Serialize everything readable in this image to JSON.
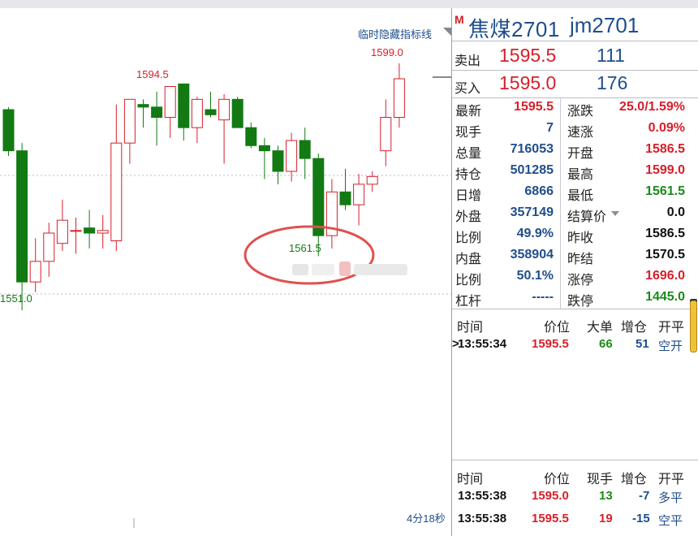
{
  "chart": {
    "hide_indicator_label": "临时隐藏指标线",
    "high_label": "1594.5",
    "high2_label": "1599.0",
    "low_label": "1561.5",
    "left_low_label": "1551.0",
    "countdown": "4分18秒",
    "colors": {
      "up": "#d6202a",
      "down": "#137a13",
      "annotation": "#e0504f"
    }
  },
  "chart_data": {
    "type": "candlestick",
    "ylim": [
      1545,
      1605
    ],
    "candles": [
      {
        "o": 1590.0,
        "h": 1590.5,
        "l": 1581.0,
        "c": 1582.0
      },
      {
        "o": 1582.0,
        "h": 1583.5,
        "l": 1551.0,
        "c": 1556.5
      },
      {
        "o": 1556.5,
        "h": 1565.0,
        "l": 1554.5,
        "c": 1560.5
      },
      {
        "o": 1560.5,
        "h": 1568.0,
        "l": 1557.5,
        "c": 1566.0
      },
      {
        "o": 1564.0,
        "h": 1572.5,
        "l": 1562.5,
        "c": 1568.5
      },
      {
        "o": 1566.5,
        "h": 1569.0,
        "l": 1562.0,
        "c": 1566.5
      },
      {
        "o": 1567.0,
        "h": 1570.5,
        "l": 1563.0,
        "c": 1566.0
      },
      {
        "o": 1566.0,
        "h": 1569.5,
        "l": 1563.0,
        "c": 1566.5
      },
      {
        "o": 1564.5,
        "h": 1591.0,
        "l": 1562.5,
        "c": 1583.5
      },
      {
        "o": 1583.5,
        "h": 1592.0,
        "l": 1579.5,
        "c": 1592.0
      },
      {
        "o": 1591.0,
        "h": 1592.0,
        "l": 1586.5,
        "c": 1590.5
      },
      {
        "o": 1590.5,
        "h": 1593.5,
        "l": 1583.0,
        "c": 1588.5
      },
      {
        "o": 1588.5,
        "h": 1594.5,
        "l": 1584.5,
        "c": 1594.5
      },
      {
        "o": 1595.0,
        "h": 1595.0,
        "l": 1584.0,
        "c": 1586.5
      },
      {
        "o": 1586.5,
        "h": 1592.5,
        "l": 1583.5,
        "c": 1592.0
      },
      {
        "o": 1590.0,
        "h": 1593.5,
        "l": 1588.5,
        "c": 1589.0
      },
      {
        "o": 1588.0,
        "h": 1593.0,
        "l": 1579.5,
        "c": 1592.0
      },
      {
        "o": 1592.0,
        "h": 1592.5,
        "l": 1586.5,
        "c": 1586.5
      },
      {
        "o": 1586.5,
        "h": 1587.5,
        "l": 1582.5,
        "c": 1583.0
      },
      {
        "o": 1583.0,
        "h": 1584.5,
        "l": 1576.5,
        "c": 1582.0
      },
      {
        "o": 1582.0,
        "h": 1583.0,
        "l": 1575.5,
        "c": 1578.0
      },
      {
        "o": 1578.0,
        "h": 1585.5,
        "l": 1576.0,
        "c": 1584.0
      },
      {
        "o": 1584.0,
        "h": 1586.5,
        "l": 1576.5,
        "c": 1580.5
      },
      {
        "o": 1580.5,
        "h": 1581.5,
        "l": 1561.5,
        "c": 1565.5
      },
      {
        "o": 1565.5,
        "h": 1576.5,
        "l": 1563.0,
        "c": 1574.0
      },
      {
        "o": 1574.0,
        "h": 1578.5,
        "l": 1570.5,
        "c": 1571.5
      },
      {
        "o": 1571.5,
        "h": 1577.5,
        "l": 1567.5,
        "c": 1575.5
      },
      {
        "o": 1575.5,
        "h": 1578.0,
        "l": 1574.0,
        "c": 1577.0
      },
      {
        "o": 1582.0,
        "h": 1592.0,
        "l": 1579.0,
        "c": 1588.5
      },
      {
        "o": 1588.5,
        "h": 1599.0,
        "l": 1586.5,
        "c": 1596.0
      }
    ]
  },
  "panel": {
    "badge": "M",
    "name": "焦煤2701",
    "code": "jm2701",
    "sell_label": "卖出",
    "sell_price": "1595.5",
    "sell_vol": "111",
    "buy_label": "买入",
    "buy_price": "1595.0",
    "buy_vol": "176",
    "stats_left": [
      {
        "label": "最新",
        "value": "1595.5",
        "color": "red"
      },
      {
        "label": "现手",
        "value": "7",
        "color": "blue"
      },
      {
        "label": "总量",
        "value": "716053",
        "color": "blue"
      },
      {
        "label": "持仓",
        "value": "501285",
        "color": "blue"
      },
      {
        "label": "日增",
        "value": "6866",
        "color": "blue"
      },
      {
        "label": "外盘",
        "value": "357149",
        "color": "blue"
      },
      {
        "label": "比例",
        "value": "49.9%",
        "color": "blue"
      },
      {
        "label": "内盘",
        "value": "358904",
        "color": "blue"
      },
      {
        "label": "比例",
        "value": "50.1%",
        "color": "blue"
      },
      {
        "label": "杠杆",
        "value": "-----",
        "color": "blue"
      }
    ],
    "stats_right": [
      {
        "label": "涨跌",
        "value": "25.0/1.59%",
        "color": "red"
      },
      {
        "label": "速涨",
        "value": "0.09%",
        "color": "red"
      },
      {
        "label": "开盘",
        "value": "1586.5",
        "color": "red"
      },
      {
        "label": "最高",
        "value": "1599.0",
        "color": "red"
      },
      {
        "label": "最低",
        "value": "1561.5",
        "color": "green"
      },
      {
        "label": "结算价",
        "value": "0.0",
        "color": "black"
      },
      {
        "label": "昨收",
        "value": "1586.5",
        "color": "black"
      },
      {
        "label": "昨结",
        "value": "1570.5",
        "color": "black"
      },
      {
        "label": "涨停",
        "value": "1696.0",
        "color": "red"
      },
      {
        "label": "跌停",
        "value": "1445.0",
        "color": "green"
      }
    ],
    "big_order_header": {
      "time": "时间",
      "price": "价位",
      "big": "大单",
      "add": "增仓",
      "type": "开平"
    },
    "big_orders": [
      {
        "time": "13:55:34",
        "price": "1595.5",
        "big": "66",
        "add": "51",
        "type": "空开"
      }
    ],
    "tick_header": {
      "time": "时间",
      "price": "价位",
      "vol": "现手",
      "add": "增仓",
      "type": "开平"
    },
    "ticks": [
      {
        "time": "13:55:38",
        "price": "1595.0",
        "vol": "13",
        "add": "-7",
        "type": "多平"
      },
      {
        "time": "13:55:38",
        "price": "1595.5",
        "vol": "19",
        "add": "-15",
        "type": "空平"
      }
    ]
  }
}
